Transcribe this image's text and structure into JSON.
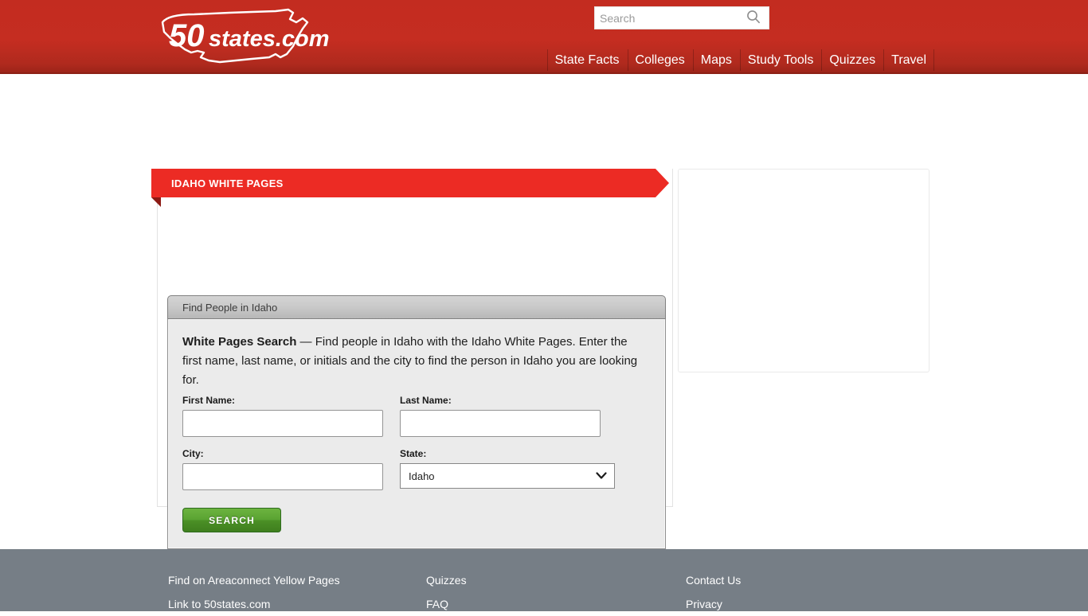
{
  "header": {
    "logo": {
      "name": "50states.com",
      "part_bold": "50",
      "part_italic": "states.com"
    },
    "search": {
      "placeholder": "Search",
      "value": "",
      "icon": "search-icon"
    },
    "nav": [
      {
        "label": "State Facts"
      },
      {
        "label": "Colleges"
      },
      {
        "label": "Maps"
      },
      {
        "label": "Study Tools"
      },
      {
        "label": "Quizzes"
      },
      {
        "label": "Travel"
      }
    ],
    "colors": {
      "brand_red": "#c52d21",
      "brand_red_dark": "#9d2419"
    }
  },
  "main": {
    "ribbon_title": "IDAHO WHITE PAGES",
    "ribbon_color": "#ec2b24",
    "panel": {
      "header_title": "Find People in Idaho",
      "intro_bold": "White Pages Search",
      "intro_text": " — Find people in Idaho with the Idaho White Pages. Enter the first name, last name, or initials and the city to find the person in Idaho you are looking for.",
      "fields": {
        "first_name": {
          "label": "First Name:",
          "value": "",
          "placeholder": ""
        },
        "last_name": {
          "label": "Last Name:",
          "value": "",
          "placeholder": ""
        },
        "city": {
          "label": "City:",
          "value": "",
          "placeholder": ""
        },
        "state": {
          "label": "State:",
          "selected": "Idaho",
          "icon": "chevron-down-icon"
        }
      },
      "submit_label": "SEARCH",
      "submit_color": "#5aa332"
    }
  },
  "sidebar": {
    "ad_placeholder": ""
  },
  "footer": {
    "background": "#767e86",
    "columns": [
      {
        "links": [
          {
            "label": "Find on Areaconnect Yellow Pages"
          },
          {
            "label": "Link to 50states.com"
          }
        ]
      },
      {
        "links": [
          {
            "label": "Quizzes"
          },
          {
            "label": "FAQ"
          }
        ]
      },
      {
        "links": [
          {
            "label": "Contact Us"
          },
          {
            "label": "Privacy"
          }
        ]
      }
    ]
  }
}
